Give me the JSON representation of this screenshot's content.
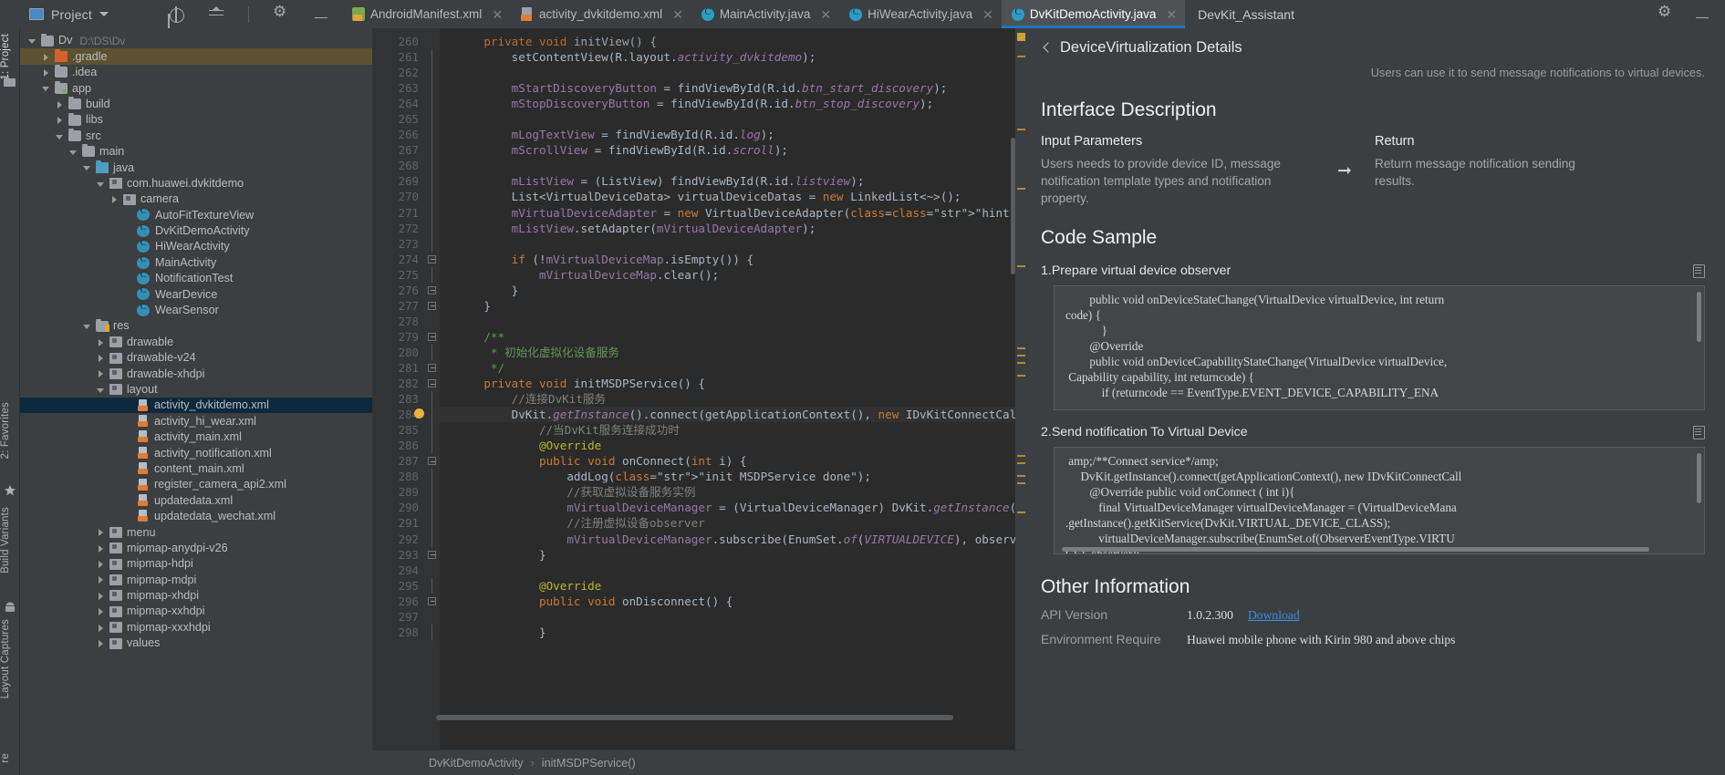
{
  "toolbar": {
    "project_label": "Project",
    "icons": [
      "locate-icon",
      "collapse-all-icon",
      "settings-icon",
      "minimize-icon"
    ]
  },
  "tabs": [
    {
      "label": "AndroidManifest.xml",
      "icon": "xml-manifest-icon",
      "active": false
    },
    {
      "label": "activity_dvkitdemo.xml",
      "icon": "xml-layout-icon",
      "active": false
    },
    {
      "label": "MainActivity.java",
      "icon": "java-class-icon",
      "active": false
    },
    {
      "label": "HiWearActivity.java",
      "icon": "java-class-icon",
      "active": false
    },
    {
      "label": "DvKitDemoActivity.java",
      "icon": "java-class-icon",
      "active": true
    }
  ],
  "rail": [
    {
      "label": "1: Project"
    },
    {
      "label": "2: Favorites"
    },
    {
      "label": "Build Variants"
    },
    {
      "label": "Layout Captures"
    },
    {
      "label": "re"
    }
  ],
  "tree": [
    {
      "indent": 0,
      "arrow": "open",
      "icon": "folder-project",
      "label": "Dv",
      "path": "D:\\DS\\Dv",
      "state": "normal"
    },
    {
      "indent": 1,
      "arrow": "closed",
      "icon": "folder-orange",
      "label": ".gradle",
      "state": "highlight"
    },
    {
      "indent": 1,
      "arrow": "closed",
      "icon": "folder",
      "label": ".idea",
      "state": "normal"
    },
    {
      "indent": 1,
      "arrow": "open",
      "icon": "folder-module",
      "label": "app",
      "state": "normal"
    },
    {
      "indent": 2,
      "arrow": "closed",
      "icon": "folder",
      "label": "build",
      "state": "normal"
    },
    {
      "indent": 2,
      "arrow": "closed",
      "icon": "folder",
      "label": "libs",
      "state": "normal"
    },
    {
      "indent": 2,
      "arrow": "open",
      "icon": "folder",
      "label": "src",
      "state": "normal"
    },
    {
      "indent": 3,
      "arrow": "open",
      "icon": "folder",
      "label": "main",
      "state": "normal"
    },
    {
      "indent": 4,
      "arrow": "open",
      "icon": "folder-blue",
      "label": "java",
      "state": "normal"
    },
    {
      "indent": 5,
      "arrow": "open",
      "icon": "package",
      "label": "com.huawei.dvkitdemo",
      "state": "normal"
    },
    {
      "indent": 6,
      "arrow": "closed",
      "icon": "package",
      "label": "camera",
      "state": "normal"
    },
    {
      "indent": 7,
      "arrow": "none",
      "icon": "class",
      "label": "AutoFitTextureView",
      "state": "normal"
    },
    {
      "indent": 7,
      "arrow": "none",
      "icon": "class",
      "label": "DvKitDemoActivity",
      "state": "normal"
    },
    {
      "indent": 7,
      "arrow": "none",
      "icon": "class",
      "label": "HiWearActivity",
      "state": "normal"
    },
    {
      "indent": 7,
      "arrow": "none",
      "icon": "class",
      "label": "MainActivity",
      "state": "normal"
    },
    {
      "indent": 7,
      "arrow": "none",
      "icon": "class",
      "label": "NotificationTest",
      "state": "normal"
    },
    {
      "indent": 7,
      "arrow": "none",
      "icon": "class",
      "label": "WearDevice",
      "state": "normal"
    },
    {
      "indent": 7,
      "arrow": "none",
      "icon": "class",
      "label": "WearSensor",
      "state": "normal"
    },
    {
      "indent": 4,
      "arrow": "open",
      "icon": "folder-res",
      "label": "res",
      "state": "normal"
    },
    {
      "indent": 5,
      "arrow": "closed",
      "icon": "package",
      "label": "drawable",
      "state": "normal"
    },
    {
      "indent": 5,
      "arrow": "closed",
      "icon": "package",
      "label": "drawable-v24",
      "state": "normal"
    },
    {
      "indent": 5,
      "arrow": "closed",
      "icon": "package",
      "label": "drawable-xhdpi",
      "state": "normal"
    },
    {
      "indent": 5,
      "arrow": "open",
      "icon": "package",
      "label": "layout",
      "state": "normal"
    },
    {
      "indent": 7,
      "arrow": "none",
      "icon": "xml",
      "label": "activity_dvkitdemo.xml",
      "state": "selected"
    },
    {
      "indent": 7,
      "arrow": "none",
      "icon": "xml",
      "label": "activity_hi_wear.xml",
      "state": "normal"
    },
    {
      "indent": 7,
      "arrow": "none",
      "icon": "xml",
      "label": "activity_main.xml",
      "state": "normal"
    },
    {
      "indent": 7,
      "arrow": "none",
      "icon": "xml",
      "label": "activity_notification.xml",
      "state": "normal"
    },
    {
      "indent": 7,
      "arrow": "none",
      "icon": "xml",
      "label": "content_main.xml",
      "state": "normal"
    },
    {
      "indent": 7,
      "arrow": "none",
      "icon": "xml",
      "label": "register_camera_api2.xml",
      "state": "normal"
    },
    {
      "indent": 7,
      "arrow": "none",
      "icon": "xml",
      "label": "updatedata.xml",
      "state": "normal"
    },
    {
      "indent": 7,
      "arrow": "none",
      "icon": "xml",
      "label": "updatedata_wechat.xml",
      "state": "normal"
    },
    {
      "indent": 5,
      "arrow": "closed",
      "icon": "package",
      "label": "menu",
      "state": "normal"
    },
    {
      "indent": 5,
      "arrow": "closed",
      "icon": "package",
      "label": "mipmap-anydpi-v26",
      "state": "normal"
    },
    {
      "indent": 5,
      "arrow": "closed",
      "icon": "package",
      "label": "mipmap-hdpi",
      "state": "normal"
    },
    {
      "indent": 5,
      "arrow": "closed",
      "icon": "package",
      "label": "mipmap-mdpi",
      "state": "normal"
    },
    {
      "indent": 5,
      "arrow": "closed",
      "icon": "package",
      "label": "mipmap-xhdpi",
      "state": "normal"
    },
    {
      "indent": 5,
      "arrow": "closed",
      "icon": "package",
      "label": "mipmap-xxhdpi",
      "state": "normal"
    },
    {
      "indent": 5,
      "arrow": "closed",
      "icon": "package",
      "label": "mipmap-xxxhdpi",
      "state": "normal"
    },
    {
      "indent": 5,
      "arrow": "closed",
      "icon": "package",
      "label": "values",
      "state": "normal"
    }
  ],
  "editor": {
    "first_line": 260,
    "lines": [
      {
        "n": 260,
        "fold": "open",
        "text": "    private void initView() {",
        "partial": true
      },
      {
        "n": 261,
        "fold": "line",
        "text": "        setContentView(R.layout.activity_dvkitdemo);"
      },
      {
        "n": 262,
        "fold": "line",
        "text": ""
      },
      {
        "n": 263,
        "fold": "line",
        "text": "        mStartDiscoveryButton = findViewById(R.id.btn_start_discovery);"
      },
      {
        "n": 264,
        "fold": "line",
        "text": "        mStopDiscoveryButton = findViewById(R.id.btn_stop_discovery);"
      },
      {
        "n": 265,
        "fold": "line",
        "text": ""
      },
      {
        "n": 266,
        "fold": "line",
        "text": "        mLogTextView = findViewById(R.id.log);"
      },
      {
        "n": 267,
        "fold": "line",
        "text": "        mScrollView = findViewById(R.id.scroll);"
      },
      {
        "n": 268,
        "fold": "line",
        "text": ""
      },
      {
        "n": 269,
        "fold": "line",
        "text": "        mListView = (ListView) findViewById(R.id.listview);"
      },
      {
        "n": 270,
        "fold": "line",
        "text": "        List<VirtualDeviceData> virtualDeviceDatas = new LinkedList<~>();"
      },
      {
        "n": 271,
        "fold": "line",
        "text": "        mVirtualDeviceAdapter = new VirtualDeviceAdapter( context: this, virtualDeviceDatas);"
      },
      {
        "n": 272,
        "fold": "line",
        "text": "        mListView.setAdapter(mVirtualDeviceAdapter);"
      },
      {
        "n": 273,
        "fold": "line",
        "text": ""
      },
      {
        "n": 274,
        "fold": "box",
        "text": "        if (!mVirtualDeviceMap.isEmpty()) {"
      },
      {
        "n": 275,
        "fold": "line",
        "text": "            mVirtualDeviceMap.clear();"
      },
      {
        "n": 276,
        "fold": "box",
        "text": "        }"
      },
      {
        "n": 277,
        "fold": "box",
        "text": "    }"
      },
      {
        "n": 278,
        "fold": "none",
        "text": ""
      },
      {
        "n": 279,
        "fold": "box",
        "text": "    /**"
      },
      {
        "n": 280,
        "fold": "line",
        "text": "     * 初始化虚拟化设备服务"
      },
      {
        "n": 281,
        "fold": "box",
        "text": "     */"
      },
      {
        "n": 282,
        "fold": "box",
        "text": "    private void initMSDPService() {"
      },
      {
        "n": 283,
        "fold": "line",
        "text": "        //连接DvKit服务"
      },
      {
        "n": 284,
        "fold": "lamp",
        "text": "        DvKit.getInstance().connect(getApplicationContext(), new IDvKitConnectCallback() {",
        "current": true
      },
      {
        "n": 285,
        "fold": "line",
        "text": "            //当DvKit服务连接成功时"
      },
      {
        "n": 286,
        "fold": "line",
        "text": "            @Override"
      },
      {
        "n": 287,
        "fold": "box",
        "text": "            public void onConnect(int i) {",
        "marker": "override"
      },
      {
        "n": 288,
        "fold": "line",
        "text": "                addLog(\"init MSDPService done\");"
      },
      {
        "n": 289,
        "fold": "line",
        "text": "                //获取虚拟设备服务实例"
      },
      {
        "n": 290,
        "fold": "line",
        "text": "                mVirtualDeviceManager = (VirtualDeviceManager) DvKit.getInstance().getKitService(VIRTUAL_DEVICE"
      },
      {
        "n": 291,
        "fold": "line",
        "text": "                //注册虚拟设备observer"
      },
      {
        "n": 292,
        "fold": "line",
        "text": "                mVirtualDeviceManager.subscribe(EnumSet.of(VIRTUALDEVICE), observer);"
      },
      {
        "n": 293,
        "fold": "box",
        "text": "            }"
      },
      {
        "n": 294,
        "fold": "none",
        "text": ""
      },
      {
        "n": 295,
        "fold": "line",
        "text": "            @Override"
      },
      {
        "n": 296,
        "fold": "box",
        "text": "            public void onDisconnect() {",
        "marker": "override"
      },
      {
        "n": 297,
        "fold": "none",
        "text": ""
      },
      {
        "n": 298,
        "fold": "line",
        "text": "            }"
      }
    ],
    "breadcrumb": [
      "DvKitDemoActivity",
      "initMSDPService()"
    ]
  },
  "assistant": {
    "window_title": "DevKit_Assistant",
    "page_title": "DeviceVirtualization Details",
    "subtitle": "Users can use it to send message notifications to virtual devices.",
    "interface_heading": "Interface Description",
    "input_label": "Input Parameters",
    "input_value": "Users needs to provide device ID, message notification template types and notification property.",
    "return_label": "Return",
    "return_value": "Return message notification sending results.",
    "code_sample_heading": "Code Sample",
    "samples": [
      {
        "title": "1.Prepare virtual device observer",
        "lines": [
          "        public void onDeviceStateChange(@VirtualDevice@ virtualDevice, int return",
          "code) {",
          "            }",
          "        %@Override%",
          "        public void onDeviceCapabilityStateChange(@VirtualDevice@ virtualDevice,",
          " @Capability@ capability, int returncode) {",
          "            if (returncode == @EventType@.EVENT_DEVICE_CAPABILITY_ENA"
        ]
      },
      {
        "title": "2.Send notification To Virtual Device",
        "lines": [
          " &/**Connect service*/&",
          "     @DvKit@.getInstance().connect(getApplicationContext(), new @IDvKitConnectCall@",
          "        %@Override% public void onConnect ( int i){",
          "           final @VirtualDeviceManager@ virtualDeviceManager = (@VirtualDeviceMana@",
          ".getInstance().getKitService(@DvKit@.VIRTUAL_DEVICE_CLASS);",
          "           virtualDeviceManager.subscribe(@EnumSet@.of(@ObserverEventType@.VIRTU",
          "CE), observer);"
        ]
      }
    ],
    "other_heading": "Other Information",
    "other": [
      {
        "key": "API Version",
        "value": "1.0.2.300",
        "link": "Download"
      },
      {
        "key": "Environment Require",
        "value": "Huawei mobile phone with Kirin 980 and above chips",
        "link": ""
      }
    ]
  },
  "colors": {
    "accent": "#2675bf",
    "panel_bg": "#3c3f41",
    "editor_bg": "#2b2b2b",
    "selection": "#0d293e",
    "link": "#3a8ee6"
  }
}
